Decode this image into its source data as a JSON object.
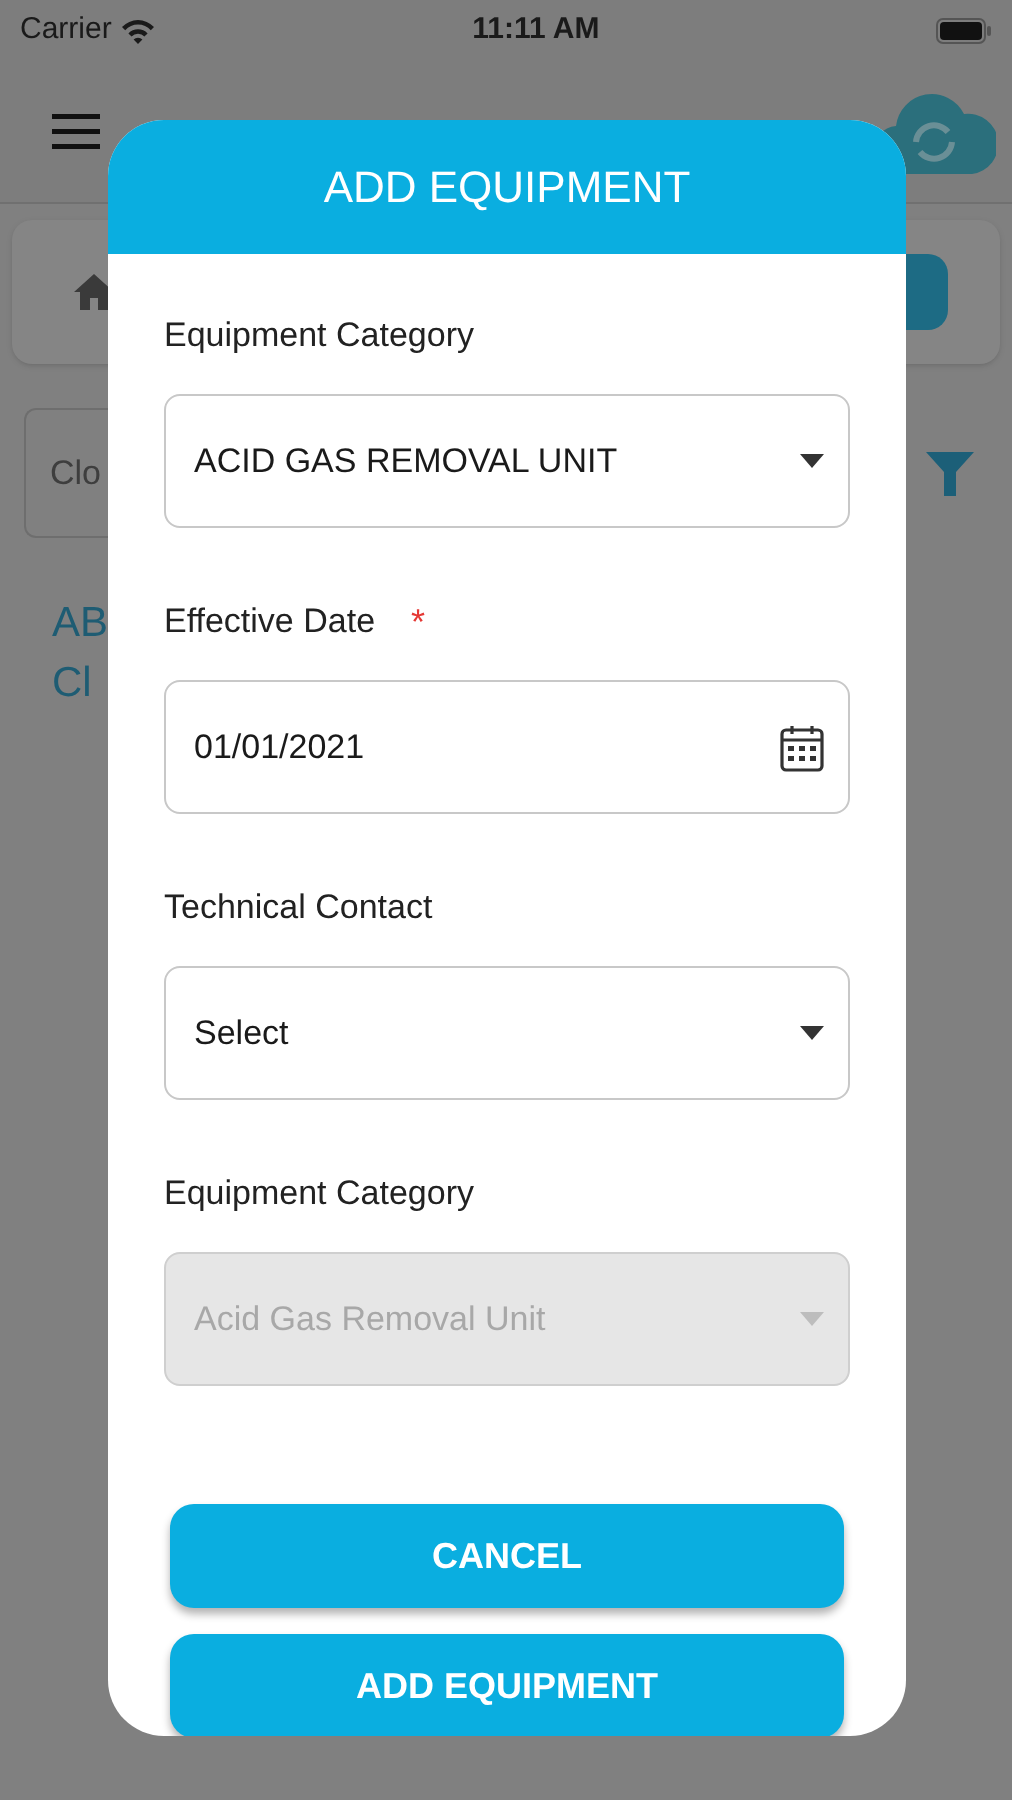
{
  "status_bar": {
    "carrier": "Carrier",
    "time": "11:11 AM"
  },
  "background": {
    "search_field": {
      "placeholder": "Clo"
    },
    "title_lines": [
      "AB",
      "Cl"
    ]
  },
  "dialog": {
    "title": "ADD EQUIPMENT",
    "fields": [
      {
        "label": "Equipment Category",
        "kind": "dropdown",
        "value": "ACID GAS REMOVAL UNIT",
        "disabled": false
      },
      {
        "label": "Effective Date",
        "required_mark": "*",
        "kind": "date",
        "value": "01/01/2021",
        "disabled": false
      },
      {
        "label": "Technical Contact",
        "kind": "dropdown",
        "value": "Select",
        "disabled": false
      },
      {
        "label": "Equipment Category",
        "kind": "dropdown",
        "value": "Acid Gas Removal Unit",
        "disabled": true
      }
    ],
    "buttons": [
      "CANCEL",
      "ADD EQUIPMENT"
    ]
  }
}
